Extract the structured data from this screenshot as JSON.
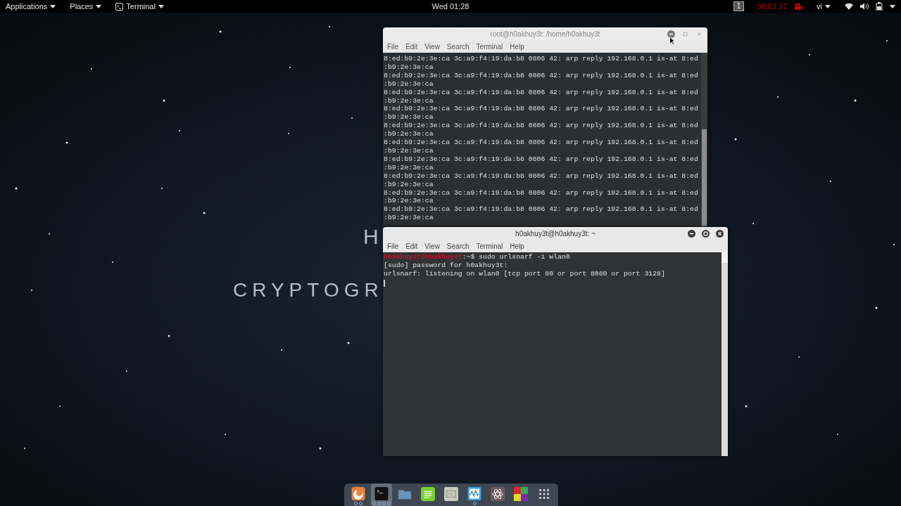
{
  "top_bar": {
    "menus": [
      {
        "label": "Applications",
        "kind": "menu"
      },
      {
        "label": "Places",
        "kind": "menu"
      },
      {
        "label": "Terminal",
        "kind": "app"
      }
    ],
    "clock": "Wed 01:28",
    "workspace": "1",
    "recording_time": "00:03:27",
    "keyboard": "vi"
  },
  "wallpaper": {
    "texts": [
      {
        "text": "H",
        "kind": "heading"
      },
      {
        "text": "CRYPTOGR",
        "kind": "subtitle"
      }
    ]
  },
  "windows": [
    {
      "title": "root@h0akhuy3t: /home/h0akhuy3t",
      "active": false,
      "menu": [
        "File",
        "Edit",
        "View",
        "Search",
        "Terminal",
        "Help"
      ],
      "lines": [
        {
          "text": "8:ed:b9:2e:3e:ca 3c:a9:f4:19:da:b8 0806 42: arp reply 192.168.0.1 is-at 8:ed"
        },
        {
          "text": ":b9:2e:3e:ca"
        },
        {
          "text": "8:ed:b9:2e:3e:ca 3c:a9:f4:19:da:b8 0806 42: arp reply 192.168.0.1 is-at 8:ed"
        },
        {
          "text": ":b9:2e:3e:ca"
        },
        {
          "text": "8:ed:b9:2e:3e:ca 3c:a9:f4:19:da:b8 0806 42: arp reply 192.168.0.1 is-at 8:ed"
        },
        {
          "text": ":b9:2e:3e:ca"
        },
        {
          "text": "8:ed:b9:2e:3e:ca 3c:a9:f4:19:da:b8 0806 42: arp reply 192.168.0.1 is-at 8:ed"
        },
        {
          "text": ":b9:2e:3e:ca"
        },
        {
          "text": "8:ed:b9:2e:3e:ca 3c:a9:f4:19:da:b8 0806 42: arp reply 192.168.0.1 is-at 8:ed"
        },
        {
          "text": ":b9:2e:3e:ca"
        },
        {
          "text": "8:ed:b9:2e:3e:ca 3c:a9:f4:19:da:b8 0806 42: arp reply 192.168.0.1 is-at 8:ed"
        },
        {
          "text": ":b9:2e:3e:ca"
        },
        {
          "text": "8:ed:b9:2e:3e:ca 3c:a9:f4:19:da:b8 0806 42: arp reply 192.168.0.1 is-at 8:ed"
        },
        {
          "text": ":b9:2e:3e:ca"
        },
        {
          "text": "8:ed:b9:2e:3e:ca 3c:a9:f4:19:da:b8 0806 42: arp reply 192.168.0.1 is-at 8:ed"
        },
        {
          "text": ":b9:2e:3e:ca"
        },
        {
          "text": "8:ed:b9:2e:3e:ca 3c:a9:f4:19:da:b8 0806 42: arp reply 192.168.0.1 is-at 8:ed"
        },
        {
          "text": ":b9:2e:3e:ca"
        },
        {
          "text": "8:ed:b9:2e:3e:ca 3c:a9:f4:19:da:b8 0806 42: arp reply 192.168.0.1 is-at 8:ed"
        },
        {
          "text": ":b9:2e:3e:ca"
        }
      ]
    },
    {
      "title": "h0akhuy3t@h0akhuy3t: ~",
      "active": true,
      "menu": [
        "File",
        "Edit",
        "View",
        "Search",
        "Terminal",
        "Help"
      ],
      "lines": [
        {
          "prompt": "h0akhuy3t@h0akhuy3t",
          "text": ":~$ sudo urlsnarf -i wlan0"
        },
        {
          "text": "[sudo] password for h0akhuy3t:"
        },
        {
          "text": "urlsnarf: listening on wlan0 [tcp port 80 or port 8080 or port 3128]"
        }
      ],
      "cursor": true
    }
  ],
  "dock": [
    {
      "kind": "browser",
      "selected": false,
      "instances": [
        {
          "kind": "window"
        },
        {
          "kind": "window"
        }
      ]
    },
    {
      "kind": "terminal",
      "selected": true,
      "instances": [
        {
          "kind": "window"
        },
        {
          "kind": "window"
        },
        {
          "kind": "window"
        },
        {
          "kind": "window"
        }
      ]
    },
    {
      "kind": "folder",
      "selected": false
    },
    {
      "kind": "notes",
      "selected": false
    },
    {
      "kind": "keyboard",
      "selected": false
    },
    {
      "kind": "monitor",
      "selected": false,
      "instances": [
        {
          "kind": "window"
        }
      ]
    },
    {
      "kind": "settings",
      "selected": false
    },
    {
      "kind": "palette",
      "selected": false
    },
    {
      "kind": "grid",
      "selected": false
    }
  ]
}
